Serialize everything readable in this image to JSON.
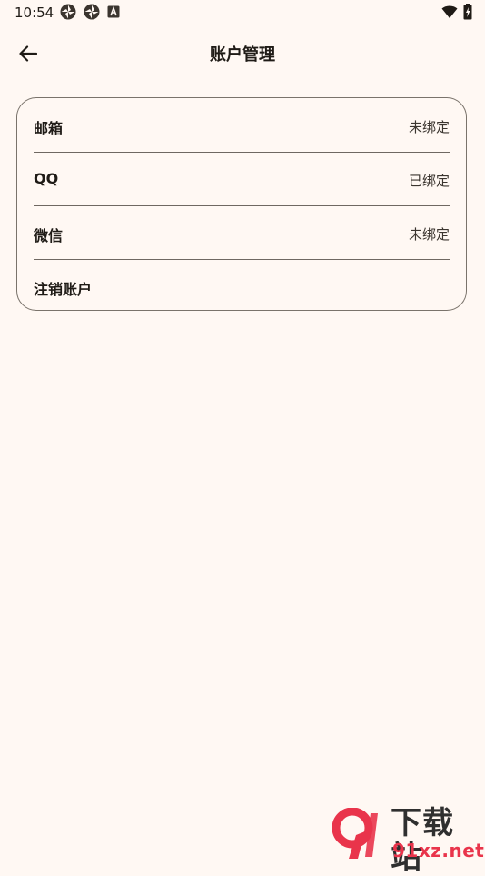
{
  "status_bar": {
    "time": "10:54",
    "left_icons": [
      "photos-pinwheel-icon",
      "photos-pinwheel-icon",
      "app-a-icon"
    ],
    "right_icons": [
      "wifi-icon",
      "battery-charging-icon"
    ]
  },
  "app_bar": {
    "back_icon": "arrow-back-icon",
    "title": "账户管理"
  },
  "account": {
    "rows": [
      {
        "label": "邮箱",
        "value": "未绑定"
      },
      {
        "label": "QQ",
        "value": "已绑定"
      },
      {
        "label": "微信",
        "value": "未绑定"
      },
      {
        "label": "注销账户",
        "value": ""
      }
    ]
  },
  "watermark": {
    "title": "下载站",
    "domain": "91xz.net"
  },
  "colors": {
    "background": "#fff8f3",
    "text": "#1f1b16",
    "border": "#7a736b",
    "watermark_red": "#e9344b"
  }
}
